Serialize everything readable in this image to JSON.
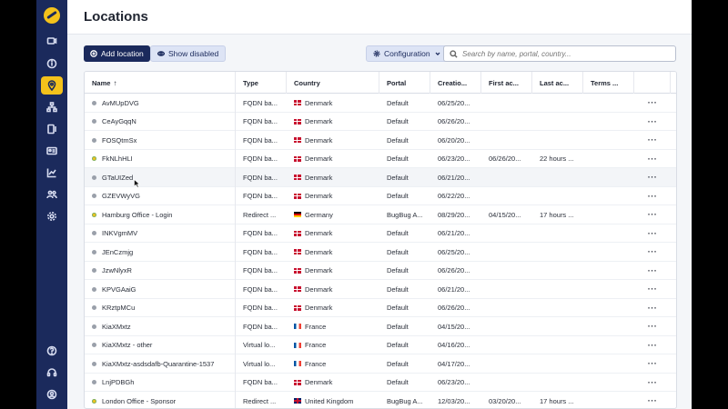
{
  "page": {
    "title": "Locations"
  },
  "sidebar": {
    "items": [
      {
        "icon": "message-icon"
      },
      {
        "icon": "info-icon"
      },
      {
        "icon": "location-pin-icon",
        "active": true
      },
      {
        "icon": "network-icon"
      },
      {
        "icon": "display-icon"
      },
      {
        "icon": "id-card-icon"
      },
      {
        "icon": "chart-icon"
      },
      {
        "icon": "users-icon"
      },
      {
        "icon": "gear-icon"
      }
    ],
    "bottom": [
      {
        "icon": "help-icon"
      },
      {
        "icon": "headset-icon"
      },
      {
        "icon": "user-icon"
      }
    ]
  },
  "toolbar": {
    "add_label": "Add location",
    "show_disabled_label": "Show disabled",
    "config_label": "Configuration",
    "search_placeholder": "Search by name, portal, country..."
  },
  "table": {
    "columns": [
      "Name",
      "Type",
      "Country",
      "Portal",
      "Creatio...",
      "First ac...",
      "Last ac...",
      "Terms ..."
    ],
    "sort_indicator": "↑",
    "rows": [
      {
        "name": "AvMUpDVG",
        "type": "FQDN ba...",
        "country": "Denmark",
        "flag": "dk",
        "portal": "Default",
        "created": "06/25/20...",
        "first": "",
        "last": "",
        "terms": "",
        "status": "gray"
      },
      {
        "name": "CeAyGqqN",
        "type": "FQDN ba...",
        "country": "Denmark",
        "flag": "dk",
        "portal": "Default",
        "created": "06/26/20...",
        "first": "",
        "last": "",
        "terms": "",
        "status": "gray"
      },
      {
        "name": "FOSQtmSx",
        "type": "FQDN ba...",
        "country": "Denmark",
        "flag": "dk",
        "portal": "Default",
        "created": "06/20/20...",
        "first": "",
        "last": "",
        "terms": "",
        "status": "gray"
      },
      {
        "name": "FkNLhHLI",
        "type": "FQDN ba...",
        "country": "Denmark",
        "flag": "dk",
        "portal": "Default",
        "created": "06/23/20...",
        "first": "06/26/20...",
        "last": "22 hours ...",
        "terms": "",
        "status": "sponsor"
      },
      {
        "name": "GTaUIZed",
        "type": "FQDN ba...",
        "country": "Denmark",
        "flag": "dk",
        "portal": "Default",
        "created": "06/21/20...",
        "first": "",
        "last": "",
        "terms": "",
        "status": "gray"
      },
      {
        "name": "GZEVWyVG",
        "type": "FQDN ba...",
        "country": "Denmark",
        "flag": "dk",
        "portal": "Default",
        "created": "06/22/20...",
        "first": "",
        "last": "",
        "terms": "",
        "status": "gray"
      },
      {
        "name": "Hamburg Office - Login",
        "type": "Redirect ...",
        "country": "Germany",
        "flag": "de",
        "portal": "BugBug A...",
        "created": "08/29/20...",
        "first": "04/15/20...",
        "last": "17 hours ...",
        "terms": "",
        "status": "sponsor"
      },
      {
        "name": "INKVgmMV",
        "type": "FQDN ba...",
        "country": "Denmark",
        "flag": "dk",
        "portal": "Default",
        "created": "06/21/20...",
        "first": "",
        "last": "",
        "terms": "",
        "status": "gray"
      },
      {
        "name": "JEnCzmjg",
        "type": "FQDN ba...",
        "country": "Denmark",
        "flag": "dk",
        "portal": "Default",
        "created": "06/25/20...",
        "first": "",
        "last": "",
        "terms": "",
        "status": "gray"
      },
      {
        "name": "JzwNlyxR",
        "type": "FQDN ba...",
        "country": "Denmark",
        "flag": "dk",
        "portal": "Default",
        "created": "06/26/20...",
        "first": "",
        "last": "",
        "terms": "",
        "status": "gray"
      },
      {
        "name": "KPVGAaiG",
        "type": "FQDN ba...",
        "country": "Denmark",
        "flag": "dk",
        "portal": "Default",
        "created": "06/21/20...",
        "first": "",
        "last": "",
        "terms": "",
        "status": "gray"
      },
      {
        "name": "KRztpMCu",
        "type": "FQDN ba...",
        "country": "Denmark",
        "flag": "dk",
        "portal": "Default",
        "created": "06/26/20...",
        "first": "",
        "last": "",
        "terms": "",
        "status": "gray"
      },
      {
        "name": "KiaXMxtz",
        "type": "FQDN ba...",
        "country": "France",
        "flag": "fr",
        "portal": "Default",
        "created": "04/15/20...",
        "first": "",
        "last": "",
        "terms": "",
        "status": "gray"
      },
      {
        "name": "KiaXMxtz - other",
        "type": "Virtual lo...",
        "country": "France",
        "flag": "fr",
        "portal": "Default",
        "created": "04/16/20...",
        "first": "",
        "last": "",
        "terms": "",
        "status": "gray"
      },
      {
        "name": "KiaXMxtz-asdsdafb-Quarantine-1537",
        "type": "Virtual lo...",
        "country": "France",
        "flag": "fr",
        "portal": "Default",
        "created": "04/17/20...",
        "first": "",
        "last": "",
        "terms": "",
        "status": "gray"
      },
      {
        "name": "LnjPDBGh",
        "type": "FQDN ba...",
        "country": "Denmark",
        "flag": "dk",
        "portal": "Default",
        "created": "06/23/20...",
        "first": "",
        "last": "",
        "terms": "",
        "status": "gray"
      },
      {
        "name": "London Office - Sponsor",
        "type": "Redirect ...",
        "country": "United Kingdom",
        "flag": "uk",
        "portal": "BugBug A...",
        "created": "12/03/20...",
        "first": "03/20/20...",
        "last": "17 hours ...",
        "terms": "",
        "status": "sponsor"
      }
    ],
    "row_action": "···"
  }
}
